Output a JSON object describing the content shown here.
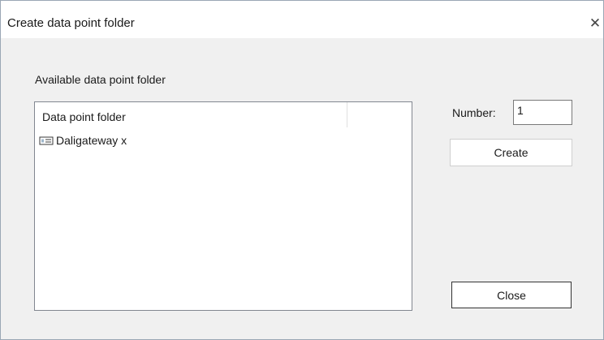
{
  "window": {
    "title": "Create data point folder",
    "close_glyph": "✕"
  },
  "group": {
    "label": "Available data point folder"
  },
  "list": {
    "column_header": "Data point folder",
    "items": [
      {
        "icon": "folder-card-icon",
        "label": "Daligateway x"
      }
    ]
  },
  "number": {
    "label": "Number:",
    "value": "1"
  },
  "buttons": {
    "create_label": "Create",
    "close_label": "Close"
  },
  "colors": {
    "window_border": "#9aa7b5",
    "dialog_background": "#f0f0f0",
    "list_border": "#828790"
  }
}
